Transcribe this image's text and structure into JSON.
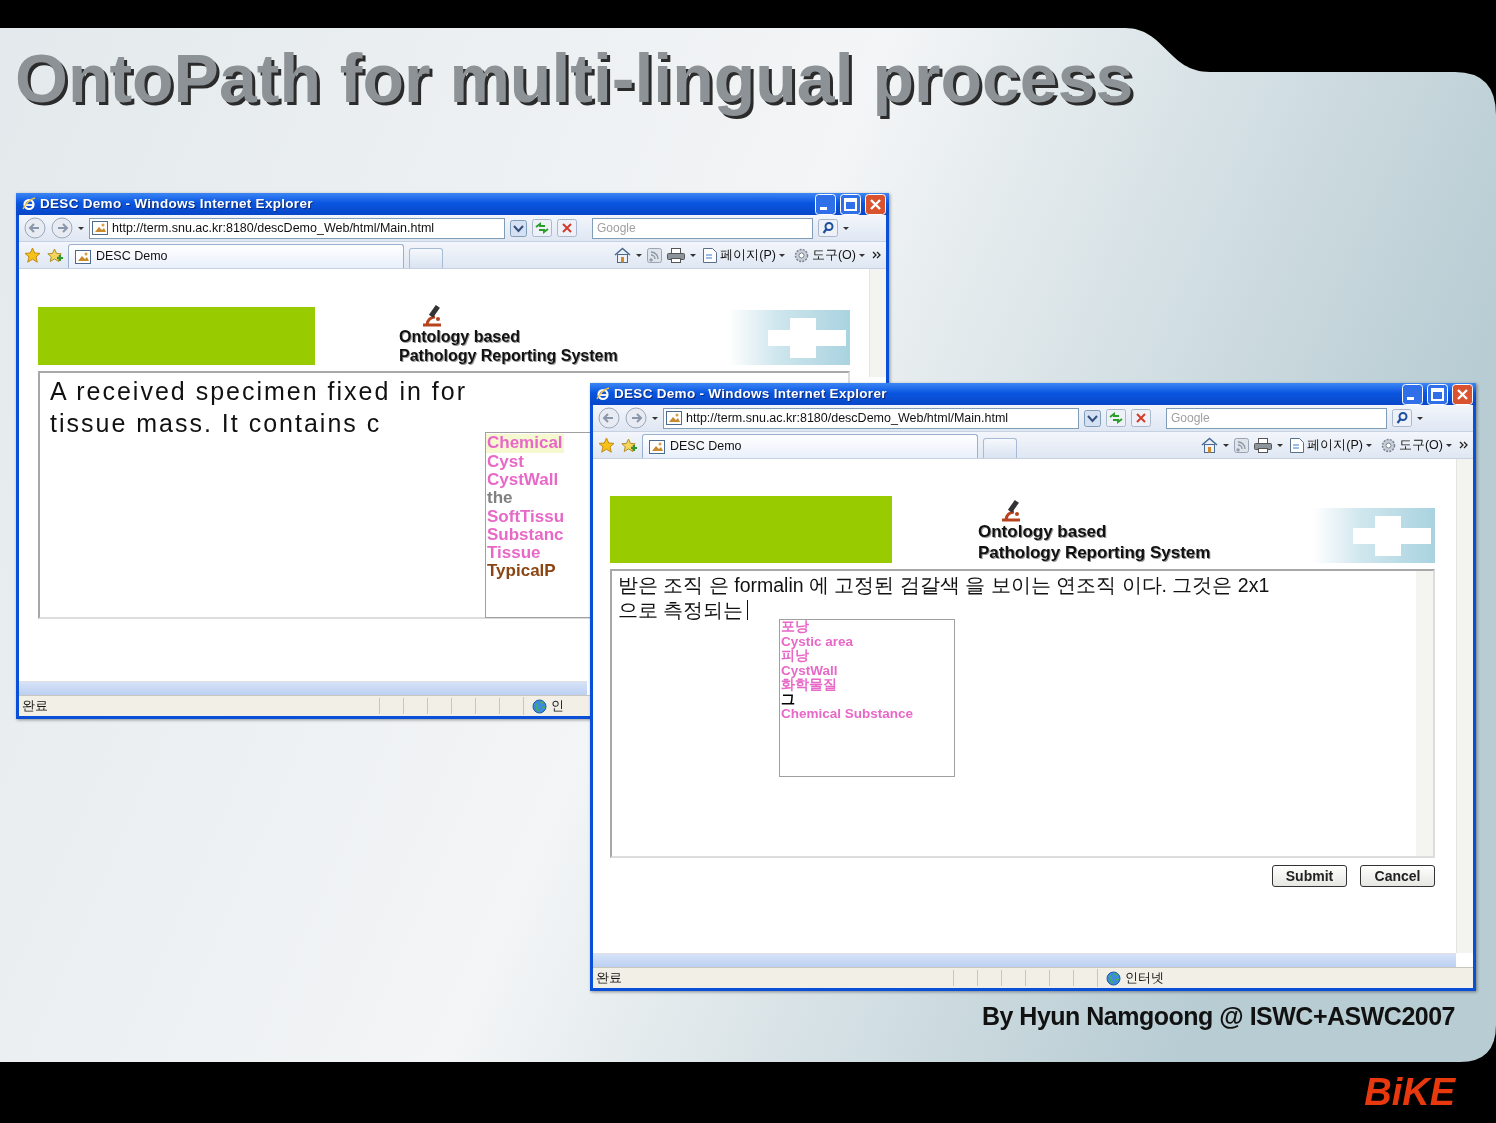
{
  "slide": {
    "title": "OntoPath for multi-lingual process",
    "credit": "By Hyun Namgoong @ ISWC+ASWC2007",
    "brand": "BiKE"
  },
  "windows": [
    {
      "title": "DESC Demo - Windows Internet Explorer",
      "address": "http://term.snu.ac.kr:8180/descDemo_Web/html/Main.html",
      "search": {
        "placeholder": "Google"
      },
      "tab": "DESC Demo",
      "menus": [
        "페이지(P)",
        "도구(O)"
      ],
      "page": {
        "header": [
          "Ontology based",
          "Pathology Reporting System"
        ],
        "report_lines": [
          "A received specimen fixed in for",
          "tissue mass. It contains c"
        ],
        "suggestions": [
          {
            "label": "Chemical",
            "color": "#e868c8",
            "selected": true
          },
          {
            "label": "Cyst",
            "color": "#e868c8",
            "selected": false
          },
          {
            "label": "CystWall",
            "color": "#e868c8",
            "selected": false
          },
          {
            "label": "the",
            "color": "#808080",
            "selected": false
          },
          {
            "label": "SoftTissu",
            "color": "#e868c8",
            "selected": false
          },
          {
            "label": "Substanc",
            "color": "#e868c8",
            "selected": false
          },
          {
            "label": "Tissue",
            "color": "#e868c8",
            "selected": false
          },
          {
            "label": "TypicalP",
            "color": "#8b4513",
            "selected": false
          }
        ]
      },
      "status": {
        "text": "완료",
        "zone": "인"
      }
    },
    {
      "title": "DESC Demo - Windows Internet Explorer",
      "address": "http://term.snu.ac.kr:8180/descDemo_Web/html/Main.html",
      "search": {
        "placeholder": "Google"
      },
      "tab": "DESC Demo",
      "menus": [
        "페이지(P)",
        "도구(O)"
      ],
      "page": {
        "header": [
          "Ontology based",
          "Pathology Reporting System"
        ],
        "report_lines": [
          "받은 조직 은 formalin 에 고정된 검갈색 을 보이는 연조직 이다. 그것은 2x1",
          "으로 측정되는"
        ],
        "cursor": true,
        "suggestions": [
          {
            "label": "포낭",
            "color": "#e868c8",
            "selected": false
          },
          {
            "label": "Cystic area",
            "color": "#e868c8",
            "selected": false
          },
          {
            "label": "피낭",
            "color": "#e868c8",
            "selected": false
          },
          {
            "label": "CystWall",
            "color": "#e868c8",
            "selected": false
          },
          {
            "label": "화학물질",
            "color": "#e868c8",
            "selected": false
          },
          {
            "label": "그",
            "color": "#000000",
            "selected": false
          },
          {
            "label": "Chemical Substance",
            "color": "#e868c8",
            "selected": false
          }
        ],
        "buttons": [
          "Submit",
          "Cancel"
        ]
      },
      "status": {
        "text": "완료",
        "zone": "인터넷"
      }
    }
  ]
}
